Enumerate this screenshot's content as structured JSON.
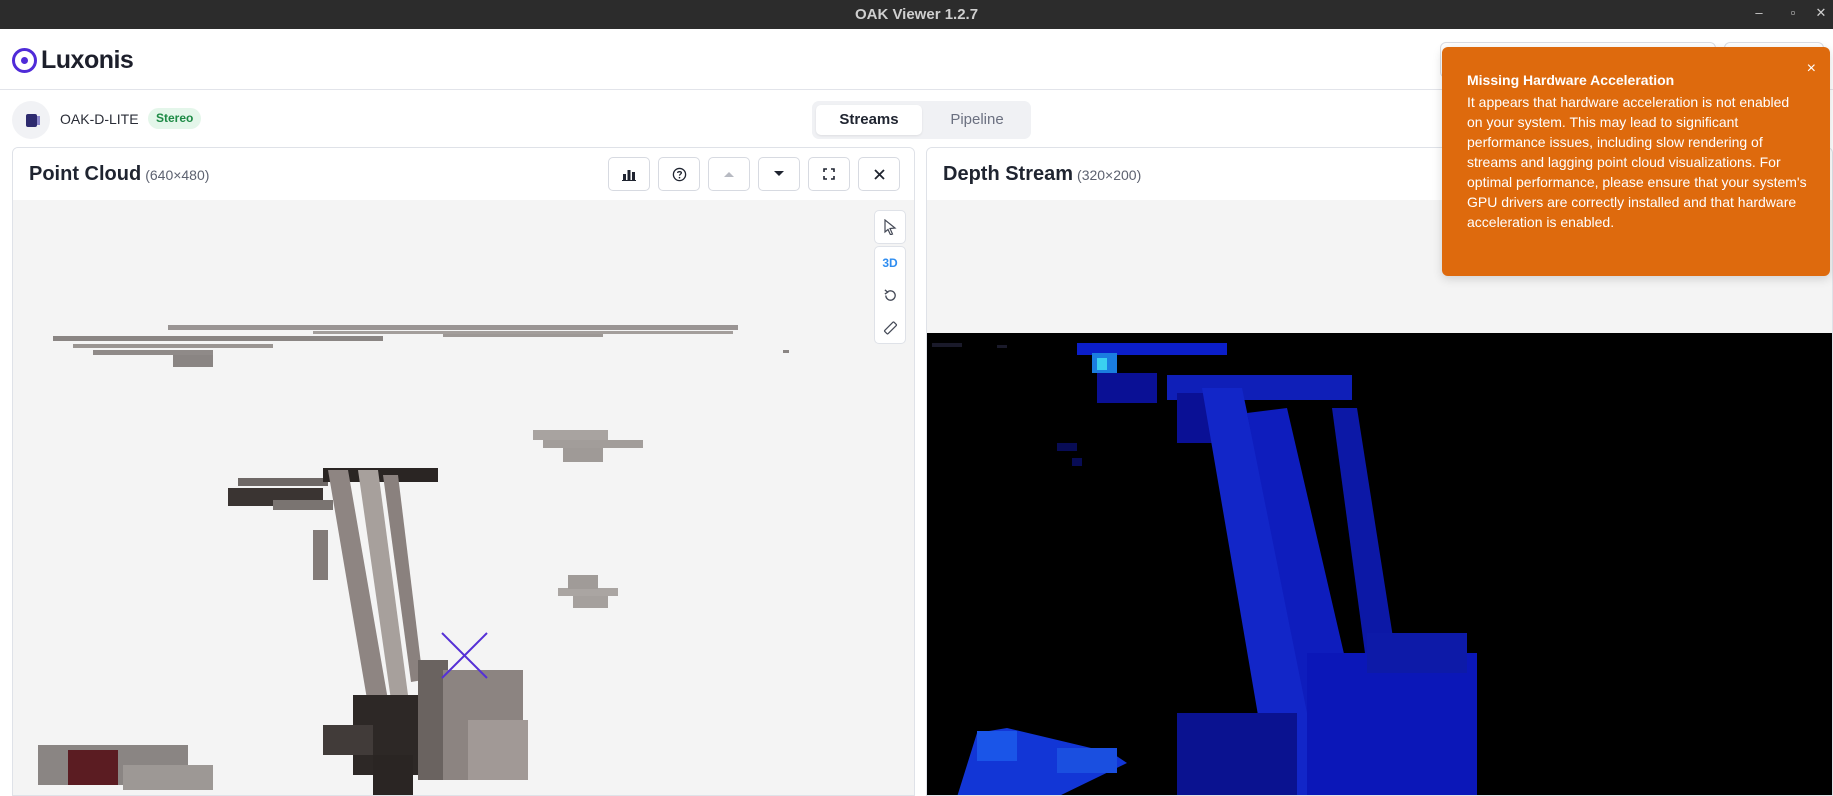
{
  "window": {
    "title": "OAK Viewer 1.2.7",
    "minimize_glyph": "–",
    "maximize_glyph": "▫",
    "close_glyph": "✕"
  },
  "header": {
    "brand": "Luxonis"
  },
  "device": {
    "name": "OAK-D-LITE",
    "badge": "Stereo"
  },
  "tabs": [
    {
      "label": "Streams",
      "active": true
    },
    {
      "label": "Pipeline",
      "active": false
    }
  ],
  "panels": {
    "point_cloud": {
      "title": "Point Cloud",
      "dims": "(640×480)",
      "tools": {
        "three_d_label": "3D"
      }
    },
    "depth": {
      "title": "Depth Stream",
      "dims": "(320×200)"
    }
  },
  "toast": {
    "title": "Missing Hardware Acceleration",
    "body": "It appears that hardware acceleration is not enabled on your system. This may lead to significant performance issues, including slow rendering of streams and lagging point cloud visualizations. For optimal performance, please ensure that your system's GPU drivers are correctly installed and that hardware acceleration is enabled.",
    "close_glyph": "×"
  },
  "colors": {
    "brand": "#4f2bd8",
    "toast_bg": "#de6a0d",
    "badge_text": "#1d8a45",
    "three_d_accent": "#2f8df0"
  }
}
